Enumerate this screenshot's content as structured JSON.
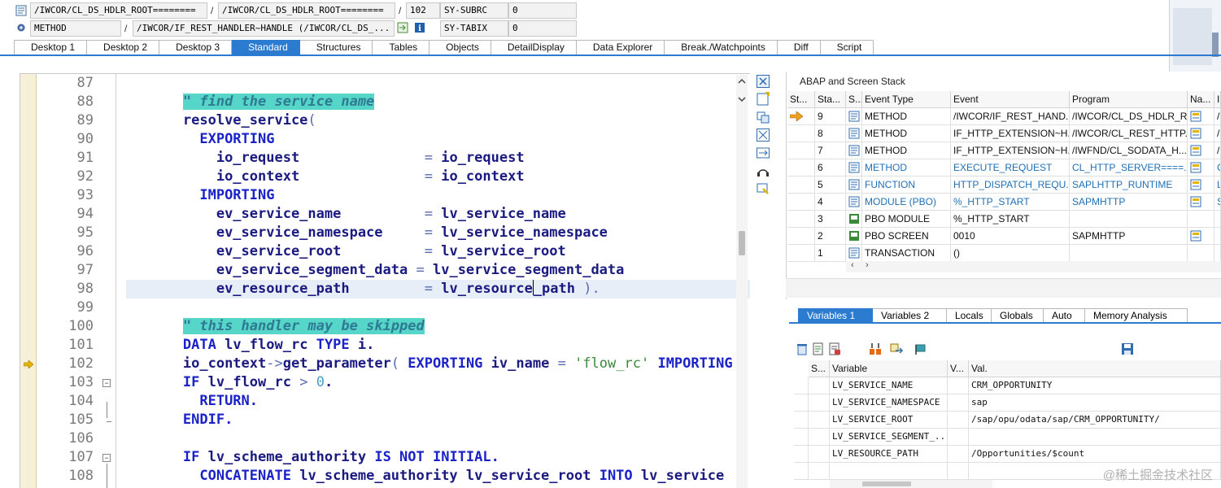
{
  "info": {
    "row1": {
      "field1": "/IWCOR/CL_DS_HDLR_ROOT========",
      "field2": "/IWCOR/CL_DS_HDLR_ROOT========",
      "line": "102",
      "var_name": "SY-SUBRC",
      "var_value": "0"
    },
    "row2": {
      "type": "METHOD",
      "method": "/IWCOR/IF_REST_HANDLER~HANDLE (/IWCOR/CL_DS_...",
      "var_name": "SY-TABIX",
      "var_value": "0"
    },
    "separator": "/"
  },
  "tabs": [
    "Desktop 1",
    "Desktop 2",
    "Desktop 3",
    "Standard",
    "Structures",
    "Tables",
    "Objects",
    "DetailDisplay",
    "Data Explorer",
    "Break./Watchpoints",
    "Diff",
    "Script"
  ],
  "code": {
    "line_numbers": [
      "87",
      "88",
      "89",
      "90",
      "91",
      "92",
      "93",
      "94",
      "95",
      "96",
      "97",
      "98",
      "99",
      "100",
      "101",
      "102",
      "103",
      "104",
      "105",
      "106",
      "107",
      "108"
    ]
  },
  "stack": {
    "title": "ABAP and Screen Stack",
    "headers": [
      "St...",
      "Sta...",
      "S...",
      "Event Type",
      "Event",
      "Program",
      "Na...",
      "I"
    ],
    "rows": [
      {
        "level": "9",
        "type": "METHOD",
        "event": "/IWCOR/IF_REST_HAND...",
        "program": "/IWCOR/CL_DS_HDLR_R...",
        "extra": "/",
        "blue": false
      },
      {
        "level": "8",
        "type": "METHOD",
        "event": "IF_HTTP_EXTENSION~H...",
        "program": "/IWCOR/CL_REST_HTTP...",
        "extra": "/",
        "blue": false
      },
      {
        "level": "7",
        "type": "METHOD",
        "event": "IF_HTTP_EXTENSION~H...",
        "program": "/IWFND/CL_SODATA_H...",
        "extra": "/",
        "blue": false
      },
      {
        "level": "6",
        "type": "METHOD",
        "event": "EXECUTE_REQUEST",
        "program": "CL_HTTP_SERVER====...",
        "extra": "C",
        "blue": true
      },
      {
        "level": "5",
        "type": "FUNCTION",
        "event": "HTTP_DISPATCH_REQU...",
        "program": "SAPLHTTP_RUNTIME",
        "extra": "L",
        "blue": true
      },
      {
        "level": "4",
        "type": "MODULE (PBO)",
        "event": "%_HTTP_START",
        "program": "SAPMHTTP",
        "extra": "S",
        "blue": true
      },
      {
        "level": "3",
        "type": "PBO MODULE",
        "event": "%_HTTP_START",
        "program": "",
        "extra": "",
        "blue": false
      },
      {
        "level": "2",
        "type": "PBO SCREEN",
        "event": "0010",
        "program": "SAPMHTTP",
        "extra": "",
        "blue": false
      },
      {
        "level": "1",
        "type": "TRANSACTION",
        "event": "()",
        "program": "",
        "extra": "",
        "blue": false
      }
    ]
  },
  "var_tabs": [
    "Variables 1",
    "Variables 2",
    "Locals",
    "Globals",
    "Auto",
    "Memory Analysis"
  ],
  "vars": {
    "headers": [
      "S...",
      "Variable",
      "V...",
      "Val."
    ],
    "rows": [
      {
        "name": "LV_SERVICE_NAME",
        "value": "CRM_OPPORTUNITY"
      },
      {
        "name": "LV_SERVICE_NAMESPACE",
        "value": "sap"
      },
      {
        "name": "LV_SERVICE_ROOT",
        "value": "/sap/opu/odata/sap/CRM_OPPORTUNITY/"
      },
      {
        "name": "LV_SERVICE_SEGMENT_...",
        "value": ""
      },
      {
        "name": "LV_RESOURCE_PATH",
        "value": "/Opportunities/$count"
      },
      {
        "name": "",
        "value": ""
      }
    ]
  },
  "watermark": "@稀土掘金技术社区"
}
